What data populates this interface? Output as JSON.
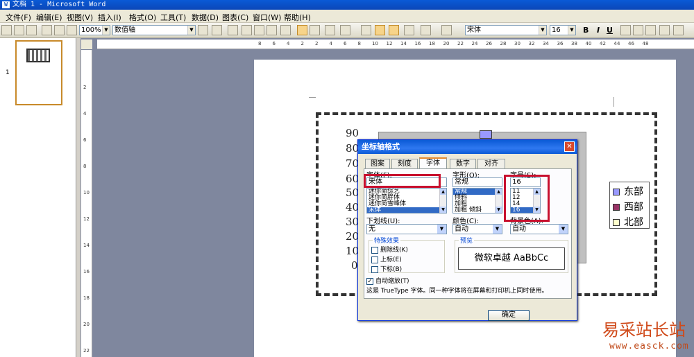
{
  "window": {
    "title": "文档 1 - Microsoft Word"
  },
  "menu": [
    "文件(F)",
    "编辑(E)",
    "视图(V)",
    "插入(I)",
    "格式(O)",
    "工具(T)",
    "数据(D)",
    "图表(C)",
    "窗口(W)",
    "帮助(H)"
  ],
  "toolbar": {
    "zoom": "100%",
    "object_select": "数值轴",
    "font": "宋体",
    "size": "16",
    "bold": "B",
    "italic": "I",
    "underline": "U"
  },
  "ruler": {
    "h_ticks": [
      "8",
      "6",
      "4",
      "2",
      "2",
      "4",
      "6",
      "8",
      "10",
      "12",
      "14",
      "16",
      "18",
      "20",
      "22",
      "24",
      "26",
      "28",
      "30",
      "32",
      "34",
      "36",
      "38",
      "40",
      "42",
      "44",
      "46",
      "48"
    ],
    "v_ticks": [
      "2",
      "4",
      "6",
      "8",
      "10",
      "12",
      "14",
      "16",
      "18",
      "20",
      "22"
    ]
  },
  "thumbnail": {
    "page_number": "1"
  },
  "chart": {
    "y_ticks": [
      "90",
      "80",
      "70",
      "60",
      "50",
      "40",
      "30",
      "20",
      "10",
      "0"
    ],
    "legend": [
      {
        "label": "东部",
        "color": "#9999ff"
      },
      {
        "label": "西部",
        "color": "#993366"
      },
      {
        "label": "北部",
        "color": "#ffffcc"
      }
    ]
  },
  "dialog": {
    "title": "坐标轴格式",
    "tabs": [
      "图案",
      "刻度",
      "字体",
      "数字",
      "对齐"
    ],
    "active_tab": "字体",
    "font_label": "字体(F):",
    "font_value": "宋体",
    "font_list": [
      "迷你简综艺",
      "迷你简胖体",
      "迷你简雪峰体",
      "宋体"
    ],
    "style_label": "字形(O):",
    "style_value": "常规",
    "style_list": [
      "常规",
      "倾斜",
      "加粗",
      "加粗 倾斜"
    ],
    "size_label": "字号(S):",
    "size_value": "16",
    "size_list": [
      "11",
      "12",
      "14",
      "16"
    ],
    "underline_label": "下划线(U):",
    "underline_value": "无",
    "color_label": "颜色(C):",
    "color_value": "自动",
    "bg_label": "背景色(A):",
    "bg_value": "自动",
    "effects_title": "特殊效果",
    "effects": [
      "删除线(K)",
      "上标(E)",
      "下标(B)"
    ],
    "preview_title": "预览",
    "preview_text": "微软卓越   AaBbCc",
    "autoscale_label": "自动缩放(T)",
    "info_text": "这是 TrueType 字体。同一种字体将在屏幕和打印机上同时使用。",
    "ok_label": "确定"
  },
  "watermark": {
    "line1": "易采站长站",
    "line2": "www.easck.com"
  }
}
